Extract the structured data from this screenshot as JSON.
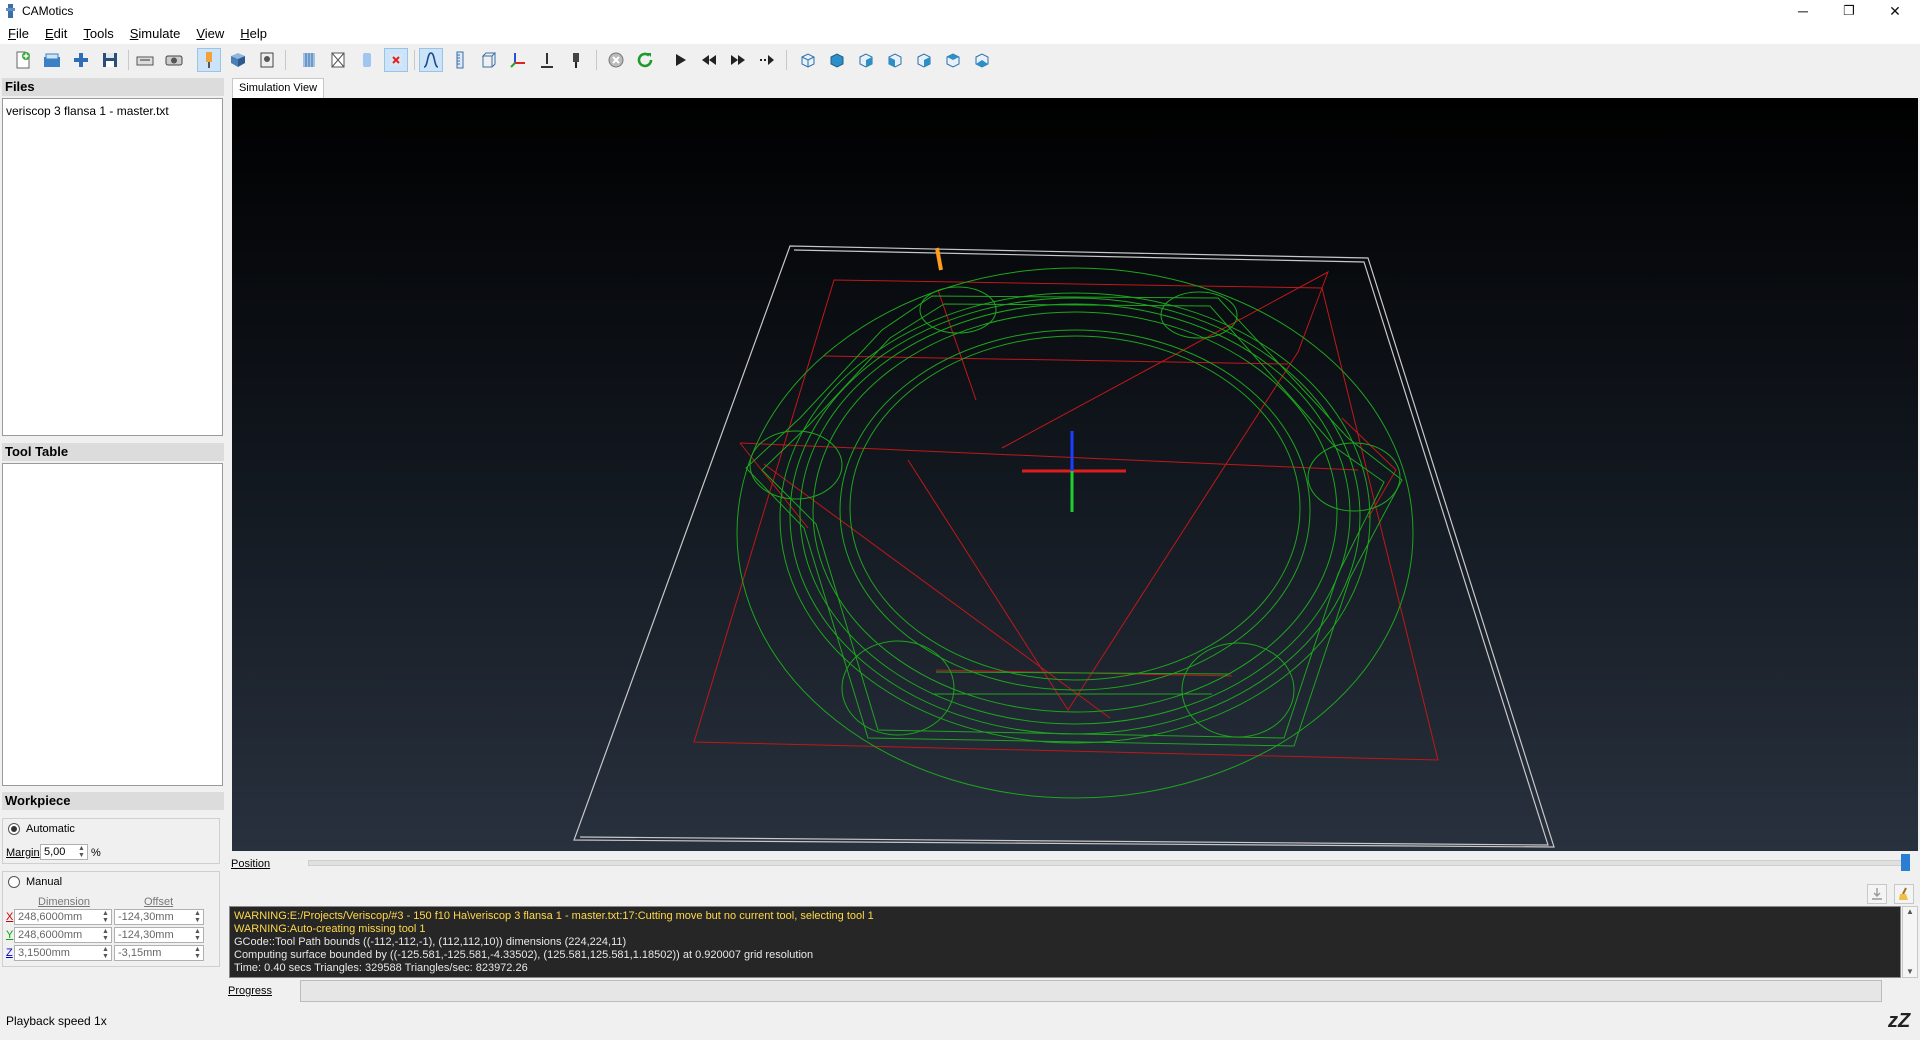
{
  "window": {
    "title": "CAMotics",
    "minimize": "─",
    "restore": "❐",
    "close": "✕"
  },
  "menu": [
    "File",
    "Edit",
    "Tools",
    "Simulate",
    "View",
    "Help"
  ],
  "panels": {
    "files": {
      "title": "Files",
      "items": [
        "veriscop 3 flansa 1 - master.txt"
      ]
    },
    "tool_table": {
      "title": "Tool Table"
    },
    "workpiece": {
      "title": "Workpiece",
      "automatic": "Automatic",
      "margin_label": "Margin",
      "margin_value": "5,00",
      "margin_unit": "%",
      "manual": "Manual",
      "dimension_header": "Dimension",
      "offset_header": "Offset",
      "rows": [
        {
          "axis": "X",
          "dimension": "248,6000mm",
          "offset": "-124,30mm"
        },
        {
          "axis": "Y",
          "dimension": "248,6000mm",
          "offset": "-124,30mm"
        },
        {
          "axis": "Z",
          "dimension": "3,1500mm",
          "offset": "-3,15mm"
        }
      ],
      "mode": "automatic"
    }
  },
  "view": {
    "tab": "Simulation View",
    "position_label": "Position",
    "position": 1.0
  },
  "console": {
    "lines": [
      {
        "text": "WARNING:E:/Projects/Veriscop/#3 - 150 f10 Ha\\veriscop 3 flansa 1 - master.txt:17:Cutting move but no current tool, selecting tool 1",
        "color": "#ffd84a"
      },
      {
        "text": "WARNING:Auto-creating missing tool 1",
        "color": "#ffd84a"
      },
      {
        "text": "GCode::Tool Path bounds ((-112,-112,-1), (112,112,10)) dimensions (224,224,11)",
        "color": "#e8e8e8"
      },
      {
        "text": "Computing surface bounded by ((-125.581,-125.581,-4.33502), (125.581,125.581,1.18502)) at 0.920007 grid resolution",
        "color": "#e8e8e8"
      },
      {
        "text": "Time: 0.40 secs Triangles: 329588 Triangles/sec: 823972.26",
        "color": "#e8e8e8"
      }
    ]
  },
  "progress": {
    "label": "Progress",
    "value": 0
  },
  "status": {
    "text": "Playback speed 1x",
    "sleep": "zZ"
  },
  "colors": {
    "toolpath_green": "#1fa51f",
    "rapid_red": "#c01818",
    "bounds_white": "#c8c8c8",
    "tool_orange": "#ff9c1a"
  }
}
